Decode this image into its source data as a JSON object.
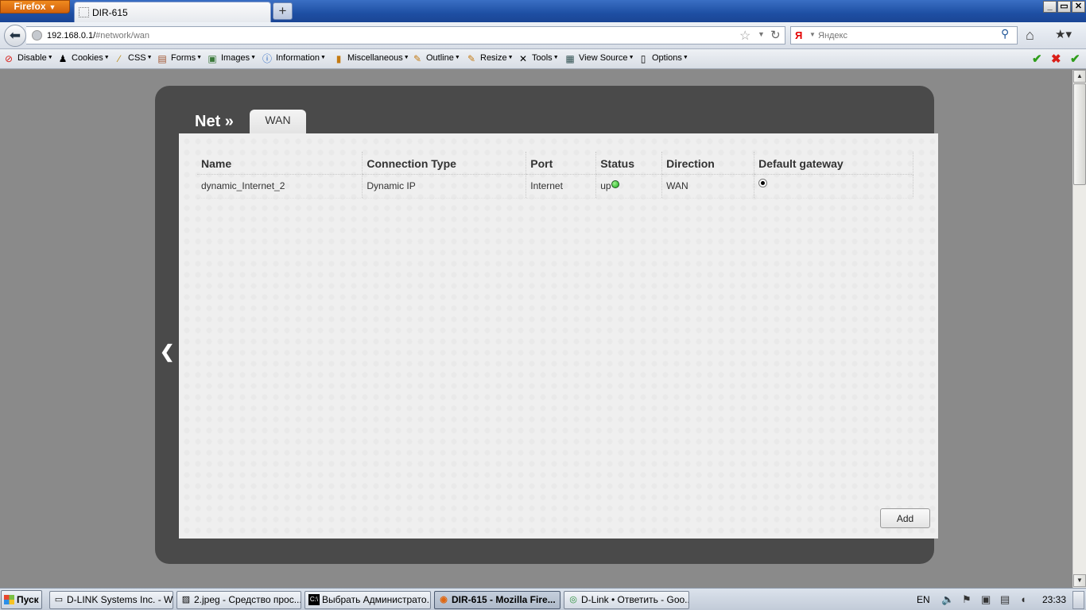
{
  "browser": {
    "menu_label": "Firefox",
    "tab_title": "DIR-615",
    "new_tab": "+",
    "url_host": "192.168.0.1/",
    "url_path": "#network/wan",
    "search_placeholder": "Яндекс",
    "window_controls": {
      "minimize": "_",
      "restore": "▭",
      "close": "✕"
    }
  },
  "devtoolbar": {
    "items": [
      {
        "label": "Disable",
        "icon": "disable-icon"
      },
      {
        "label": "Cookies",
        "icon": "cookies-icon"
      },
      {
        "label": "CSS",
        "icon": "css-wand-icon"
      },
      {
        "label": "Forms",
        "icon": "forms-icon"
      },
      {
        "label": "Images",
        "icon": "images-icon"
      },
      {
        "label": "Information",
        "icon": "information-icon"
      },
      {
        "label": "Miscellaneous",
        "icon": "miscellaneous-icon"
      },
      {
        "label": "Outline",
        "icon": "outline-pencil-icon"
      },
      {
        "label": "Resize",
        "icon": "resize-icon"
      },
      {
        "label": "Tools",
        "icon": "tools-icon"
      },
      {
        "label": "View Source",
        "icon": "view-source-icon"
      },
      {
        "label": "Options",
        "icon": "options-icon"
      }
    ],
    "status_colors": {
      "ok": "#2e9d1a",
      "error": "#d91e18"
    }
  },
  "page": {
    "heading": "Net »",
    "active_tab": "WAN",
    "table": {
      "headers": [
        "Name",
        "Connection Type",
        "Port",
        "Status",
        "Direction",
        "Default gateway"
      ],
      "rows": [
        {
          "name": "dynamic_Internet_2",
          "connection_type": "Dynamic IP",
          "port": "Internet",
          "status": "up",
          "direction": "WAN",
          "default_gateway_selected": true
        }
      ]
    },
    "add_button": "Add",
    "status_color": "#19b01a"
  },
  "taskbar": {
    "start": "Пуск",
    "items": [
      {
        "label": "D-LINK Systems Inc. - W...",
        "icon": "explorer-window-icon",
        "active": false
      },
      {
        "label": "2.jpeg - Средство прос...",
        "icon": "image-viewer-icon",
        "active": false
      },
      {
        "label": "Выбрать Администрато...",
        "icon": "cmd-icon",
        "active": false
      },
      {
        "label": "DIR-615 - Mozilla Fire...",
        "icon": "firefox-icon",
        "active": true
      },
      {
        "label": "D-Link • Ответить - Goo...",
        "icon": "chrome-icon",
        "active": false
      }
    ],
    "language": "EN",
    "clock": "23:33"
  }
}
